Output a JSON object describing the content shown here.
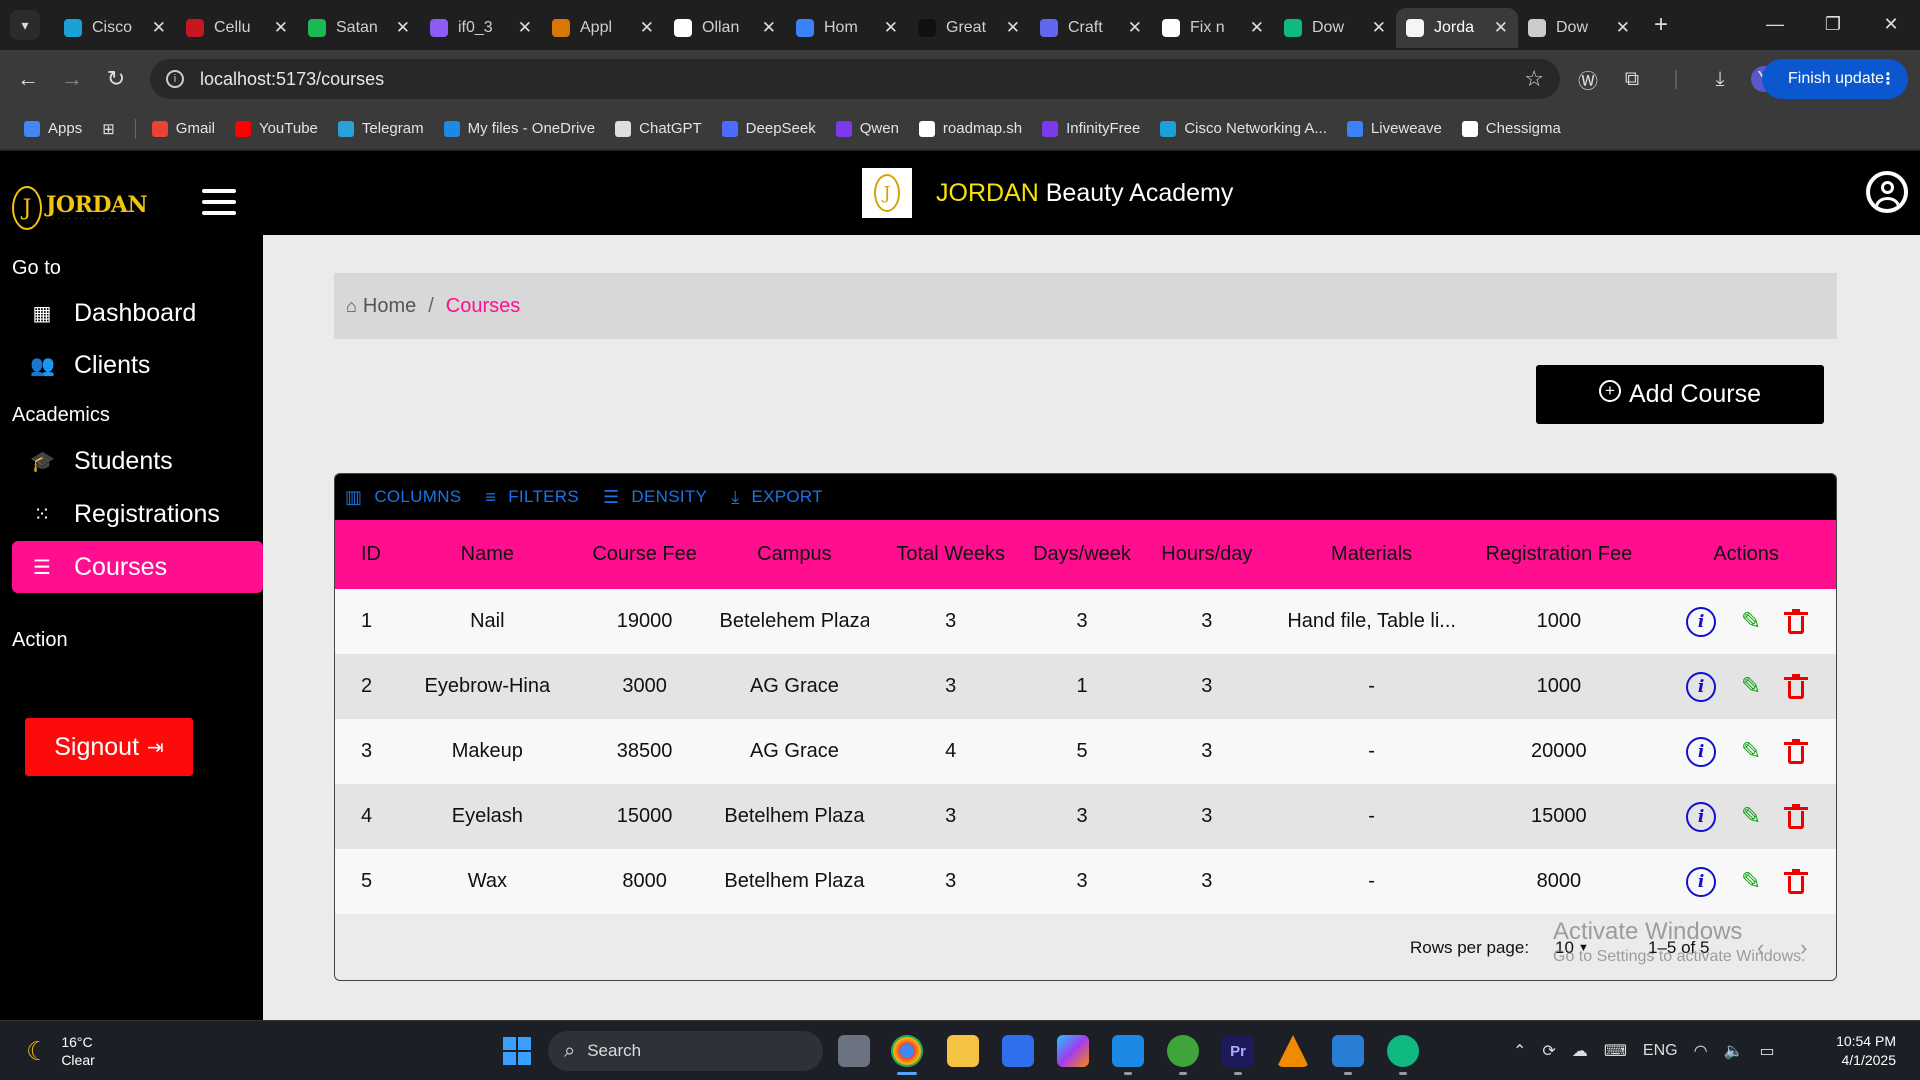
{
  "browser": {
    "tabs": [
      {
        "title": "Cisco",
        "color": "#1ba0d7"
      },
      {
        "title": "Cellu",
        "color": "#c4171f"
      },
      {
        "title": "Satan",
        "color": "#1db954"
      },
      {
        "title": "if0_3",
        "color": "#8b5cf6"
      },
      {
        "title": "Appl",
        "color": "#d97706"
      },
      {
        "title": "Ollan",
        "color": "#ffffff"
      },
      {
        "title": "Hom",
        "color": "#3b82f6"
      },
      {
        "title": "Great",
        "color": "#111111"
      },
      {
        "title": "Craft",
        "color": "#6366f1"
      },
      {
        "title": "Fix n",
        "color": "#ffffff"
      },
      {
        "title": "Dow",
        "color": "#10b981"
      },
      {
        "title": "Jorda",
        "color": "#f5f5f5",
        "active": true
      },
      {
        "title": "Dow",
        "color": "#cccccc"
      }
    ],
    "url": "localhost:5173/courses",
    "profile_initial": "Y",
    "finish_update": "Finish update",
    "bookmarks": [
      {
        "label": "Apps",
        "color": "#4285f4"
      },
      {
        "label": "Gmail",
        "color": "#ea4335"
      },
      {
        "label": "YouTube",
        "color": "#ff0000"
      },
      {
        "label": "Telegram",
        "color": "#2aa1da"
      },
      {
        "label": "My files - OneDrive",
        "color": "#1e88e5"
      },
      {
        "label": "ChatGPT",
        "color": "#dddddd"
      },
      {
        "label": "DeepSeek",
        "color": "#4d6bfe"
      },
      {
        "label": "Qwen",
        "color": "#7c3aed"
      },
      {
        "label": "roadmap.sh",
        "color": "#ffffff"
      },
      {
        "label": "InfinityFree",
        "color": "#7c3aed"
      },
      {
        "label": "Cisco Networking A...",
        "color": "#1ba0d7"
      },
      {
        "label": "Liveweave",
        "color": "#3b82f6"
      },
      {
        "label": "Chessigma",
        "color": "#ffffff"
      }
    ]
  },
  "app": {
    "logo_text": "JORDAN",
    "logo_mark": "J",
    "brand": {
      "highlight": "JORDAN",
      "rest": " Beauty Academy"
    },
    "sidebar": {
      "section_goto": "Go to",
      "section_academics": "Academics",
      "section_action": "Action",
      "items": [
        {
          "label": "Dashboard",
          "icon": "dashboard-icon"
        },
        {
          "label": "Clients",
          "icon": "clients-icon"
        },
        {
          "label": "Students",
          "icon": "students-icon"
        },
        {
          "label": "Registrations",
          "icon": "registrations-icon"
        },
        {
          "label": "Courses",
          "icon": "courses-icon",
          "active": true
        }
      ],
      "signout": "Signout"
    },
    "breadcrumb": {
      "home": "Home",
      "separator": "/",
      "current": "Courses"
    },
    "add_course": "Add Course",
    "grid": {
      "toolbar": [
        "COLUMNS",
        "FILTERS",
        "DENSITY",
        "EXPORT"
      ],
      "columns": [
        "ID",
        "Name",
        "Course Fee",
        "Campus",
        "Total Weeks",
        "Days/week",
        "Hours/day",
        "Materials",
        "Registration Fee",
        "Actions"
      ],
      "rows": [
        {
          "id": "1",
          "name": "Nail",
          "fee": "19000",
          "campus": "Betelehem Plaza",
          "weeks": "3",
          "days": "3",
          "hours": "3",
          "materials": "Hand file, Table li...",
          "reg": "1000"
        },
        {
          "id": "2",
          "name": "Eyebrow-Hina",
          "fee": "3000",
          "campus": "AG Grace",
          "weeks": "3",
          "days": "1",
          "hours": "3",
          "materials": "-",
          "reg": "1000"
        },
        {
          "id": "3",
          "name": "Makeup",
          "fee": "38500",
          "campus": "AG Grace",
          "weeks": "4",
          "days": "5",
          "hours": "3",
          "materials": "-",
          "reg": "20000"
        },
        {
          "id": "4",
          "name": "Eyelash",
          "fee": "15000",
          "campus": "Betelhem Plaza",
          "weeks": "3",
          "days": "3",
          "hours": "3",
          "materials": "-",
          "reg": "15000"
        },
        {
          "id": "5",
          "name": "Wax",
          "fee": "8000",
          "campus": "Betelhem Plaza",
          "weeks": "3",
          "days": "3",
          "hours": "3",
          "materials": "-",
          "reg": "8000"
        }
      ],
      "footer": {
        "rows_per_page_label": "Rows per page:",
        "rows_per_page": "10",
        "range": "1–5 of 5"
      }
    },
    "colors": {
      "accent_pink": "#ff0f8f",
      "signout_red": "#ff0a0a",
      "brand_yellow": "#f5e10b"
    }
  },
  "watermark": {
    "line1": "Activate Windows",
    "line2": "Go to Settings to activate Windows."
  },
  "taskbar": {
    "weather_temp": "16°C",
    "weather_desc": "Clear",
    "search_placeholder": "Search",
    "lang": "ENG",
    "time": "10:54 PM",
    "date": "4/1/2025"
  }
}
